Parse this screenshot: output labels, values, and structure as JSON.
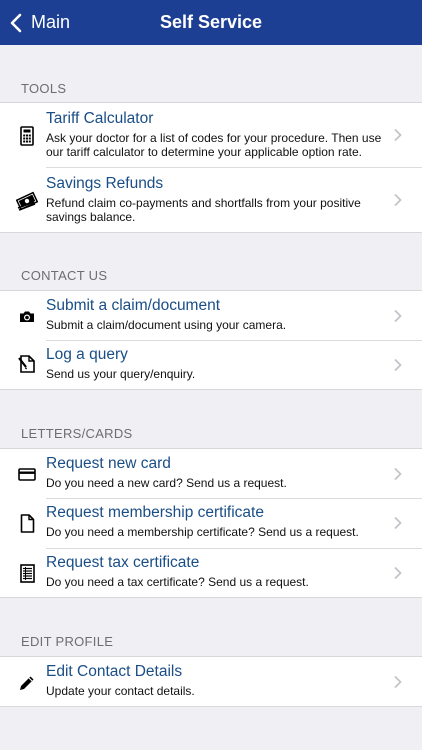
{
  "nav": {
    "back_label": "Main",
    "title": "Self Service"
  },
  "colors": {
    "navbar": "#1c3f94",
    "link": "#1a4e86",
    "background": "#efeff4"
  },
  "sections": [
    {
      "header": "TOOLS",
      "items": [
        {
          "icon": "calculator-icon",
          "title": "Tariff Calculator",
          "subtitle": "Ask your doctor for a list of codes for your procedure.  Then use our tariff calculator to determine your applicable option rate."
        },
        {
          "icon": "money-icon",
          "title": "Savings Refunds",
          "subtitle": "Refund claim co-payments and shortfalls from your positive savings balance."
        }
      ]
    },
    {
      "header": "CONTACT US",
      "items": [
        {
          "icon": "camera-icon",
          "title": "Submit a claim/document",
          "subtitle": "Submit a claim/document using your camera."
        },
        {
          "icon": "edit-document-icon",
          "title": "Log a query",
          "subtitle": "Send us your query/enquiry."
        }
      ]
    },
    {
      "header": "LETTERS/CARDS",
      "items": [
        {
          "icon": "card-icon",
          "title": "Request new card",
          "subtitle": "Do you need a new card? Send us a request."
        },
        {
          "icon": "document-icon",
          "title": "Request membership certificate",
          "subtitle": "Do you need a membership certificate? Send us a request."
        },
        {
          "icon": "ledger-icon",
          "title": "Request tax certificate",
          "subtitle": "Do you need a tax certificate? Send us a request."
        }
      ]
    },
    {
      "header": "EDIT PROFILE",
      "items": [
        {
          "icon": "pencil-icon",
          "title": "Edit Contact Details",
          "subtitle": "Update your contact details."
        }
      ]
    }
  ]
}
